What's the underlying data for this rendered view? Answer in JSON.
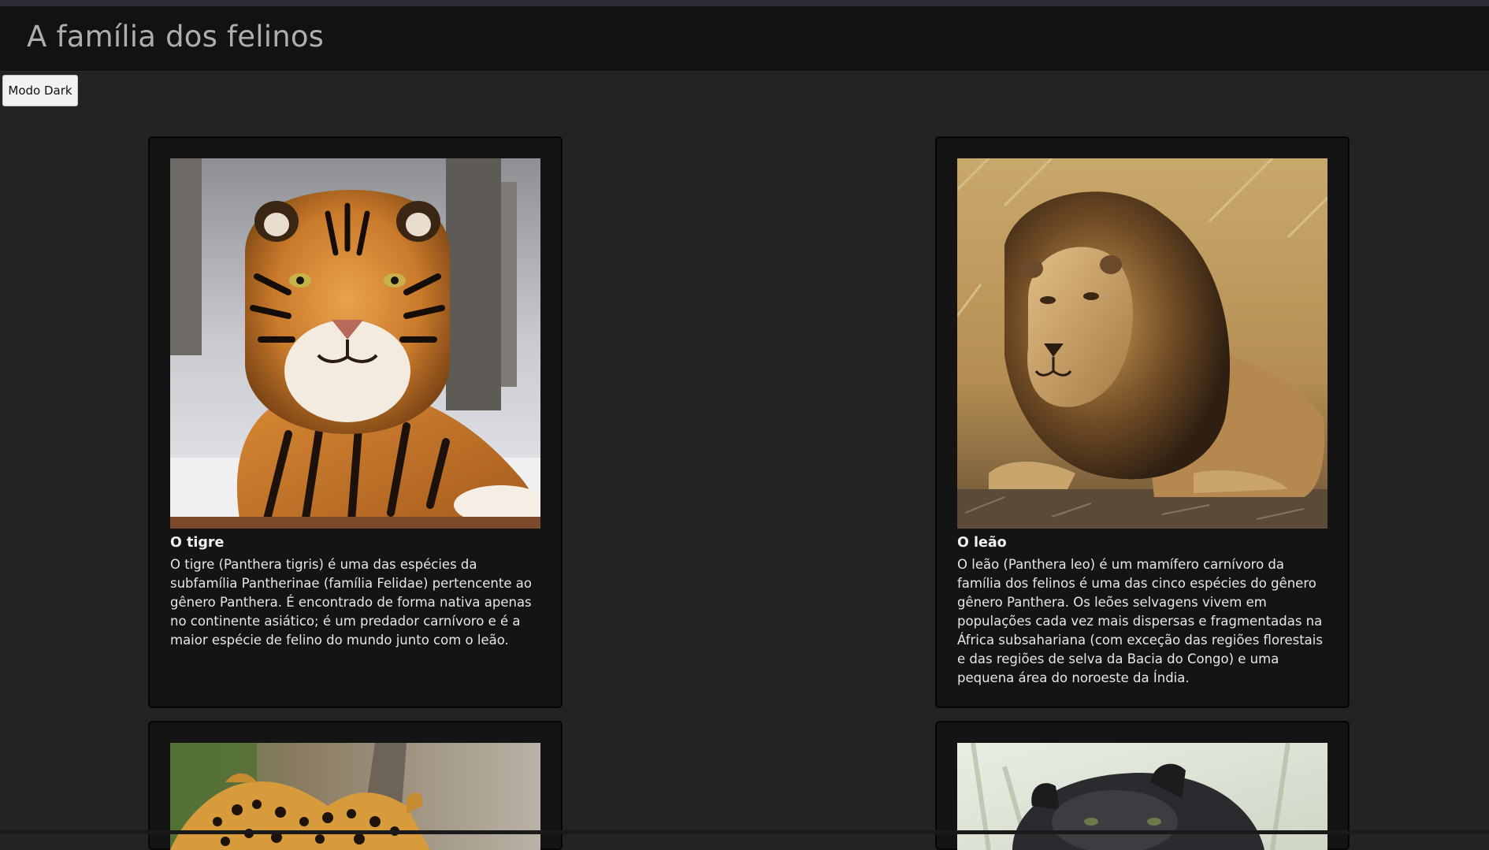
{
  "header": {
    "title": "A família dos felinos"
  },
  "toolbar": {
    "dark_mode_label": "Modo Dark"
  },
  "cards": [
    {
      "title": "O tigre",
      "text": "O tigre (Panthera tigris) é uma das espécies da subfamília Pantherinae (família Felidae) pertencente ao gênero Panthera. É encontrado de forma nativa apenas no continente asiático; é um predador carnívoro e é a maior espécie de felino do mundo junto com o leão."
    },
    {
      "title": "O leão",
      "text": "O leão (Panthera leo) é um mamífero carnívoro da família dos felinos é uma das cinco espécies do gênero gênero Panthera. Os leões selvagens vivem em populações cada vez mais dispersas e fragmentadas na África subsahariana (com exceção das regiões florestais e das regiões de selva da Bacia do Congo) e uma pequena área do noroeste da Índia."
    }
  ],
  "colors": {
    "page_background": "#232323",
    "header_background": "#121212",
    "card_background": "#141414",
    "title_text": "#aeaeae",
    "body_text": "#e6e6e6"
  }
}
